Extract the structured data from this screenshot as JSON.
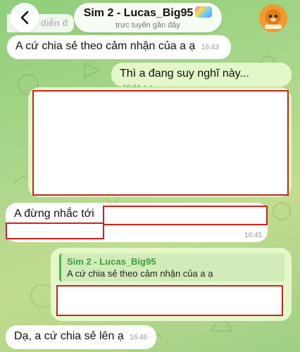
{
  "header": {
    "title": "Sim 2 - Lucas_Big95",
    "subtitle": "trực tuyến gần đây",
    "pinned_snippet": "diễn đ"
  },
  "messages": [
    {
      "id": "m1",
      "direction": "in",
      "text": "A cứ chia sẻ theo cảm nhận của a ạ",
      "time": "16:43"
    },
    {
      "id": "m2",
      "direction": "out",
      "text": "Thì a đang suy nghĩ này...",
      "time": "16:44"
    },
    {
      "id": "m3",
      "direction": "in",
      "text": "A đừng nhắc tới",
      "time": "16:45"
    },
    {
      "id": "m4",
      "direction": "out",
      "reply_name": "Sim 2 - Lucas_Big95",
      "reply_text": "A cứ chia sẻ theo cảm nhận của a ạ"
    },
    {
      "id": "m5",
      "direction": "in",
      "text": "Dạ, a cứ chia sẻ lên ạ",
      "time": "16:46"
    }
  ],
  "icons": {
    "back": "chevron-left-icon",
    "read": "double-check-icon"
  },
  "colors": {
    "outgoing_bubble": "#e4f7c8",
    "incoming_bubble": "#ffffff",
    "redaction": "#d02020",
    "accent": "#4caf50"
  }
}
